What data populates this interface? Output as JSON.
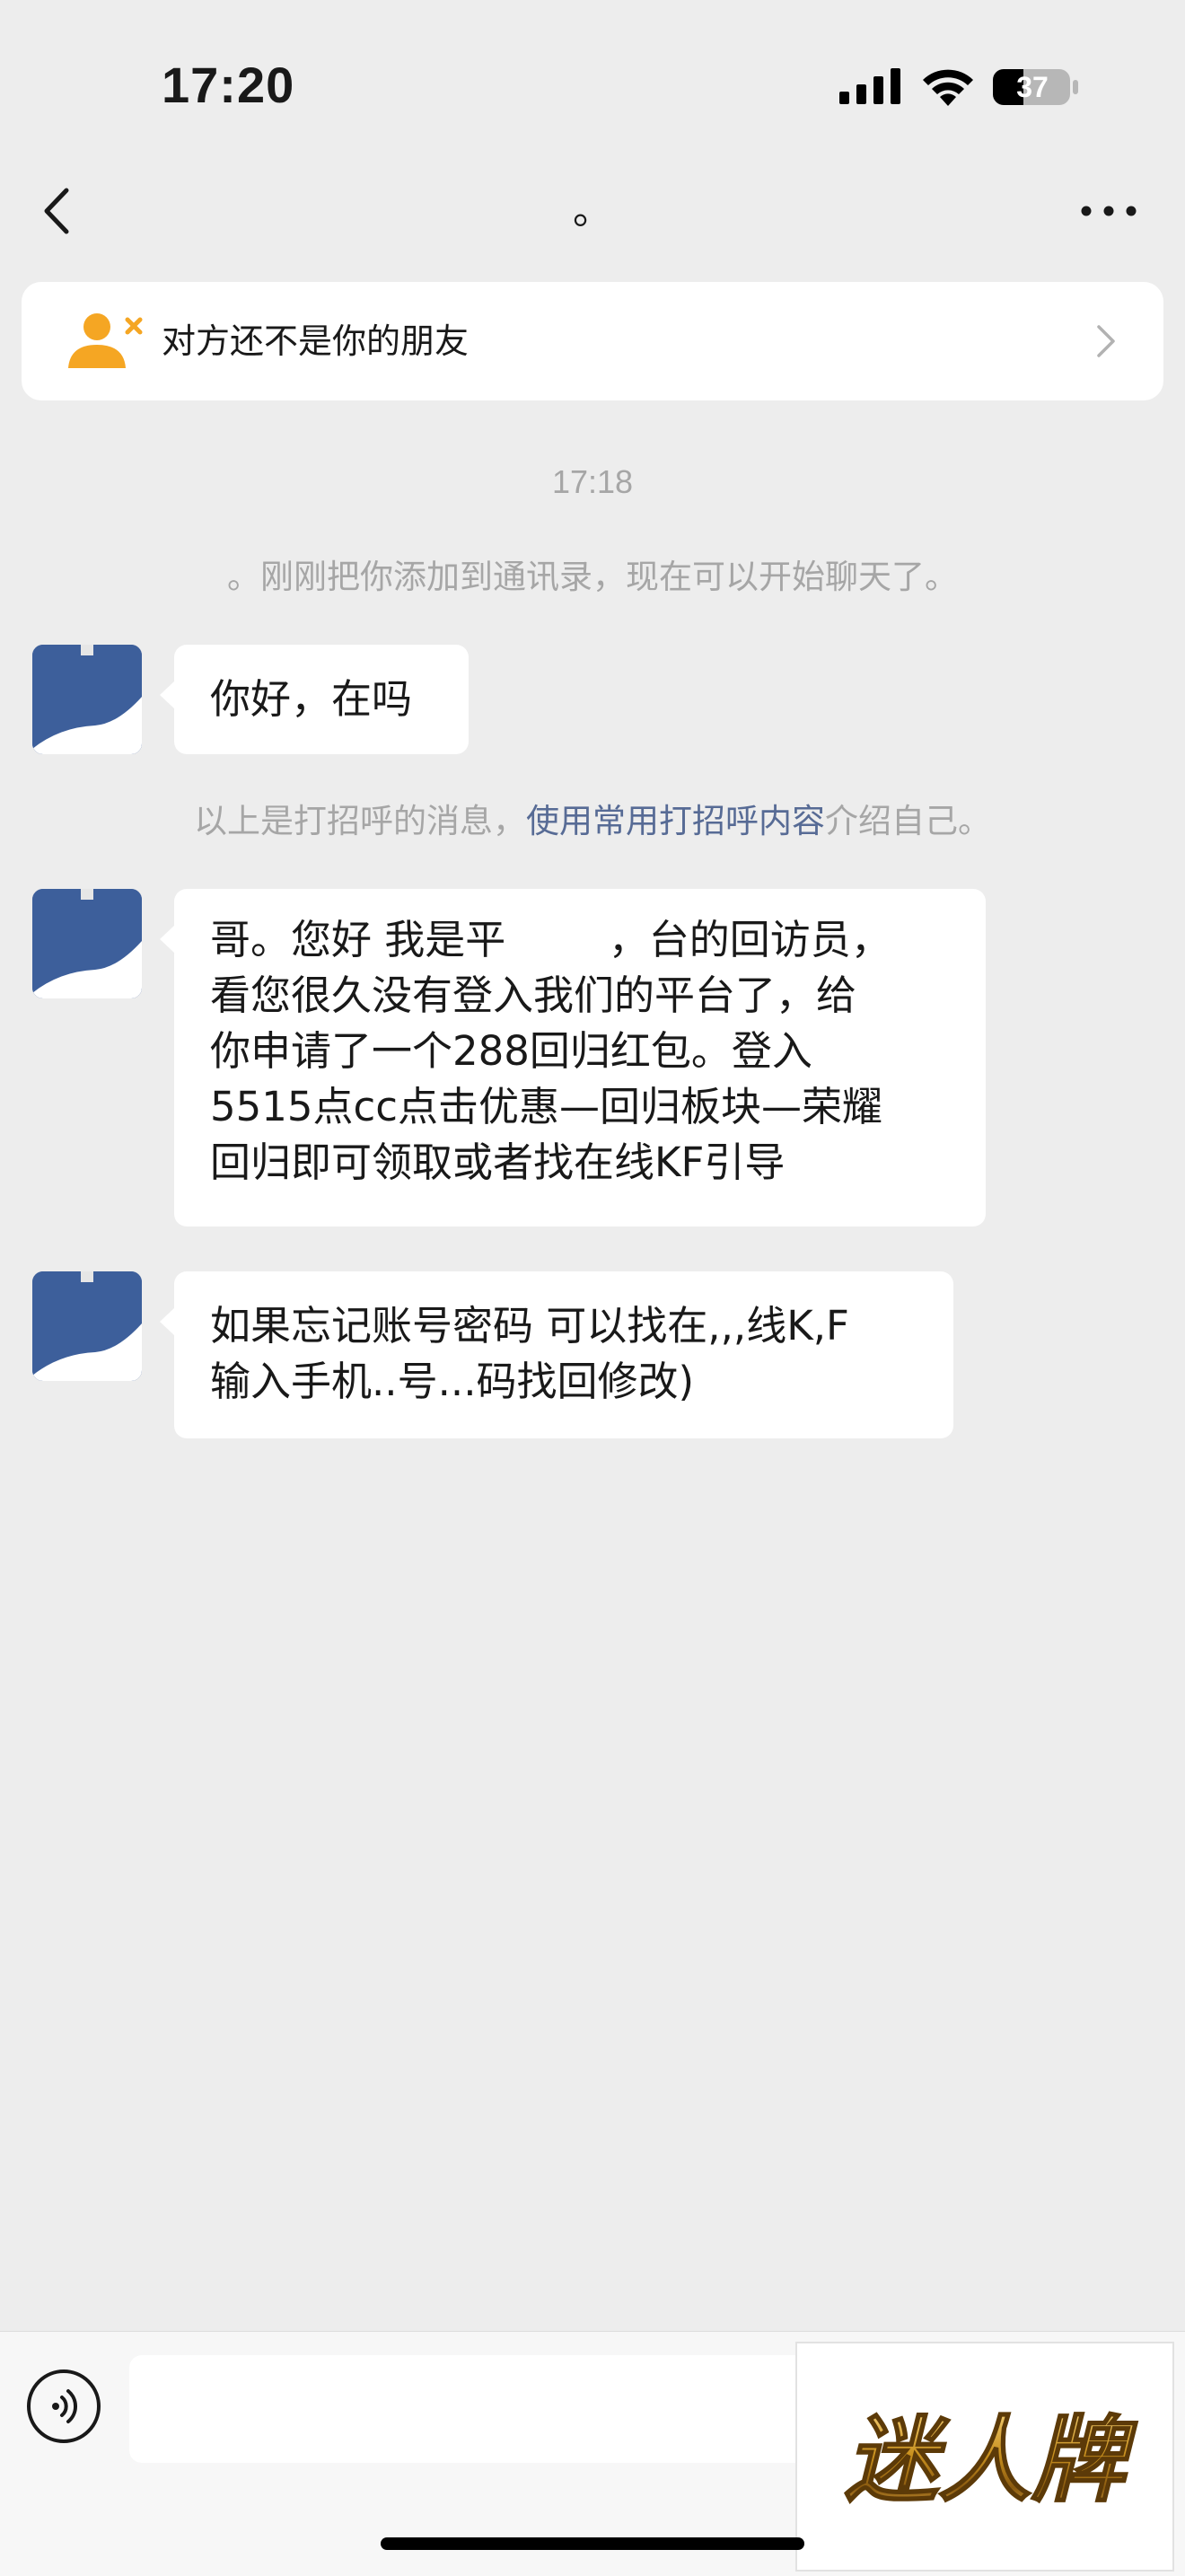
{
  "status_bar": {
    "time": "17:20",
    "battery": "37",
    "icons": [
      "signal-icon",
      "wifi-icon",
      "battery-icon"
    ]
  },
  "nav": {
    "title": "。",
    "back_icon": "chevron-left-icon",
    "more_icon": "more-dots-icon"
  },
  "banner": {
    "text": "对方还不是你的朋友",
    "icon": "add-friend-icon",
    "accent": "#f5a623"
  },
  "chat": {
    "timestamp": "17:18",
    "system_message": "。刚刚把你添加到通讯录，现在可以开始聊天了。",
    "hint_prefix": "以上是打招呼的消息，",
    "hint_link": "使用常用打招呼内容",
    "hint_suffix": "介绍自己。",
    "messages": [
      {
        "lines": [
          "你好，在吗"
        ]
      },
      {
        "lines": [
          "哥。您好 我是平        ，台的回访员，",
          "看您很久没有登入我们的平台了，给",
          "你申请了一个288回归红包。登入",
          "5515点cc点击优惠—回归板块—荣耀",
          "回归即可领取或者找在线KF引导"
        ]
      },
      {
        "lines": [
          "如果忘记账号密码 可以找在,,,线K,F",
          "输入手机..号...码找回修改)"
        ]
      }
    ]
  },
  "input_bar": {
    "voice_icon": "voice-icon",
    "input_value": ""
  },
  "watermark": {
    "text": "迷人牌"
  },
  "colors": {
    "background": "#ededed",
    "bubble": "#ffffff",
    "link": "#576b95",
    "muted": "#a6a6a6",
    "avatar": "#3d5f9b"
  }
}
